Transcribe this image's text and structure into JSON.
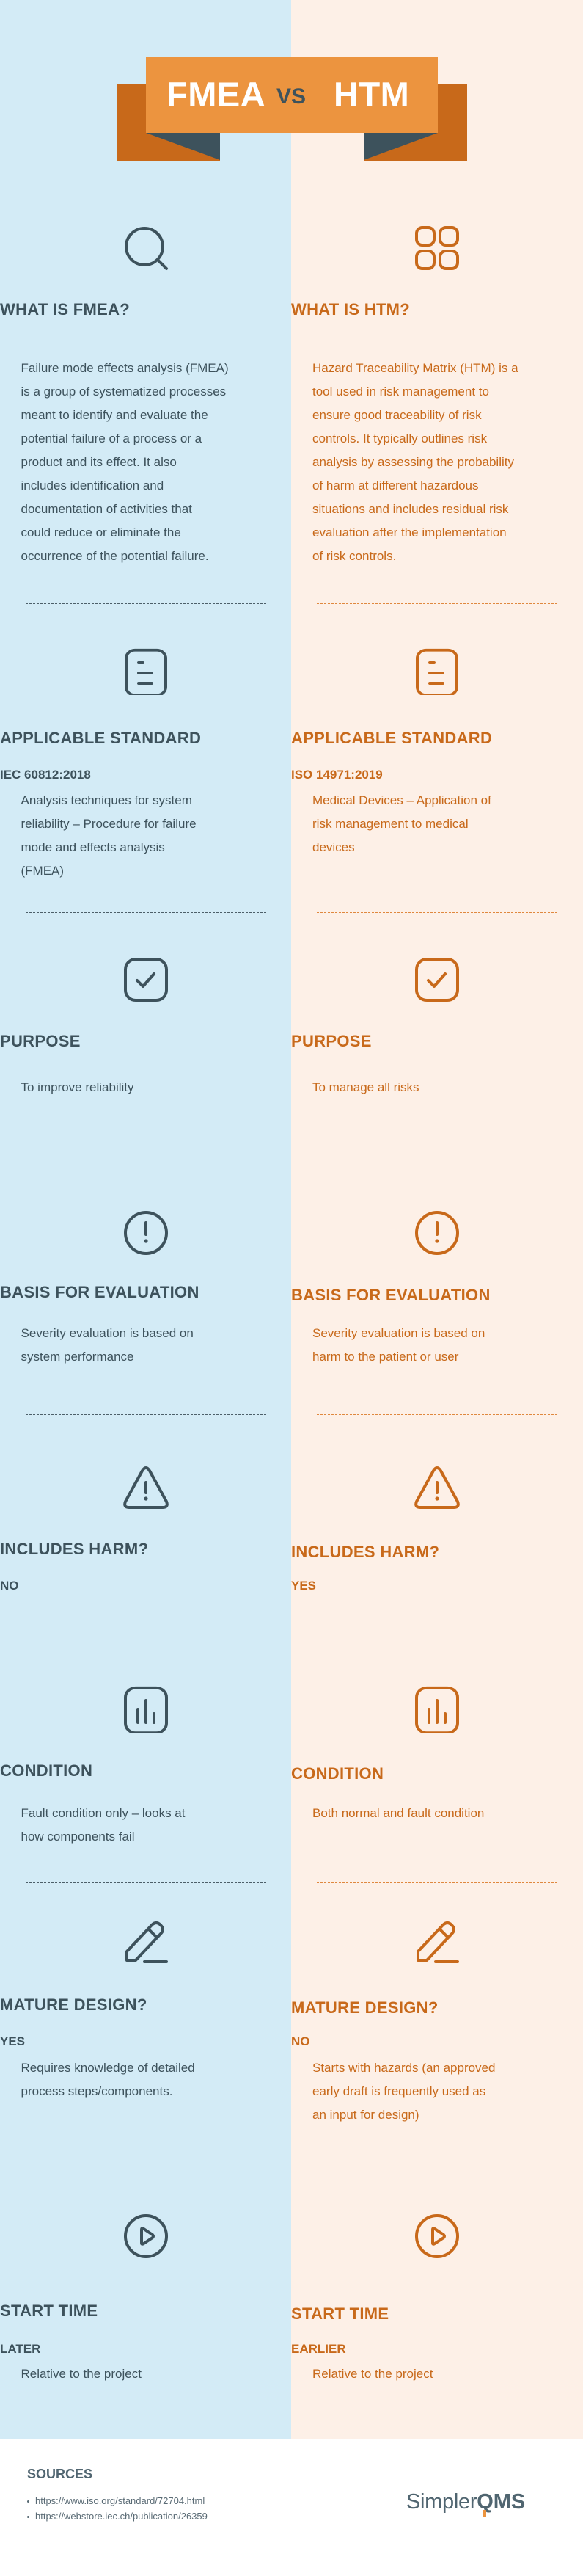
{
  "colors": {
    "left_bg": "#d3ebf6",
    "right_bg": "#fdf0e7",
    "dark": "#3d525c",
    "orange": "#c8691a",
    "banner": "#ec943f"
  },
  "header": {
    "left_title": "FMEA",
    "vs": "VS",
    "right_title": "HTM"
  },
  "left": {
    "sections": [
      {
        "icon": "search-icon",
        "title": "WHAT IS FMEA?",
        "sub": "",
        "body": [
          "Failure mode effects analysis (FMEA)",
          "is a group of systematized processes",
          "meant to identify and evaluate the",
          "potential failure of a process or a",
          "product and its effect. It also",
          "includes identification and",
          "documentation of activities that",
          "could reduce or eliminate the",
          "occurrence of the potential failure."
        ]
      },
      {
        "icon": "document-icon",
        "title": "APPLICABLE STANDARD",
        "sub": "IEC 60812:2018",
        "body": [
          "Analysis techniques for system",
          "reliability – Procedure for failure",
          "mode and effects analysis",
          "(FMEA)"
        ]
      },
      {
        "icon": "checkbox-icon",
        "title": "PURPOSE",
        "sub": "",
        "body": [
          "To improve reliability"
        ]
      },
      {
        "icon": "alert-circle-icon",
        "title": "BASIS FOR EVALUATION",
        "sub": "",
        "body": [
          "Severity evaluation is based on",
          "system performance"
        ]
      },
      {
        "icon": "warning-triangle-icon",
        "title": "INCLUDES HARM?",
        "sub": "NO",
        "body": []
      },
      {
        "icon": "bar-chart-icon",
        "title": "CONDITION",
        "sub": "",
        "body": [
          "Fault condition only – looks at",
          "how components fail"
        ]
      },
      {
        "icon": "pencil-icon",
        "title": "MATURE DESIGN?",
        "sub": "YES",
        "body": [
          "Requires knowledge of detailed",
          "process steps/components."
        ]
      },
      {
        "icon": "play-circle-icon",
        "title": "START TIME",
        "sub": "LATER",
        "body": [
          "Relative to the project"
        ]
      }
    ]
  },
  "right": {
    "sections": [
      {
        "icon": "grid-icon",
        "title": "WHAT IS HTM?",
        "sub": "",
        "body": [
          "Hazard Traceability Matrix (HTM) is a",
          "tool used in risk management to",
          "ensure good traceability of risk",
          "controls. It typically outlines risk",
          "analysis by assessing the probability",
          "of harm at different hazardous",
          "situations and includes residual risk",
          "evaluation after the implementation",
          "of risk controls."
        ]
      },
      {
        "icon": "document-icon",
        "title": "APPLICABLE STANDARD",
        "sub": "ISO 14971:2019",
        "body": [
          "Medical Devices – Application of",
          "risk management to medical",
          "devices"
        ]
      },
      {
        "icon": "checkbox-icon",
        "title": "PURPOSE",
        "sub": "",
        "body": [
          "To manage all risks"
        ]
      },
      {
        "icon": "alert-circle-icon",
        "title": "BASIS FOR EVALUATION",
        "sub": "",
        "body": [
          "Severity evaluation is based on",
          "harm to the patient or user"
        ]
      },
      {
        "icon": "warning-triangle-icon",
        "title": "INCLUDES HARM?",
        "sub": "YES",
        "body": []
      },
      {
        "icon": "bar-chart-icon",
        "title": "CONDITION",
        "sub": "",
        "body": [
          "Both normal and fault condition"
        ]
      },
      {
        "icon": "pencil-icon",
        "title": "MATURE DESIGN?",
        "sub": "NO",
        "body": [
          "Starts with hazards (an approved",
          "early draft is frequently used as",
          "an input for design)"
        ]
      },
      {
        "icon": "play-circle-icon",
        "title": "START TIME",
        "sub": "EARLIER",
        "body": [
          "Relative to the project"
        ]
      }
    ]
  },
  "footer": {
    "sources_title": "SOURCES",
    "sources": [
      "https://www.iso.org/standard/72704.html",
      "https://webstore.iec.ch/publication/26359"
    ],
    "logo_light": "Simpler",
    "logo_bold": "QMS"
  }
}
